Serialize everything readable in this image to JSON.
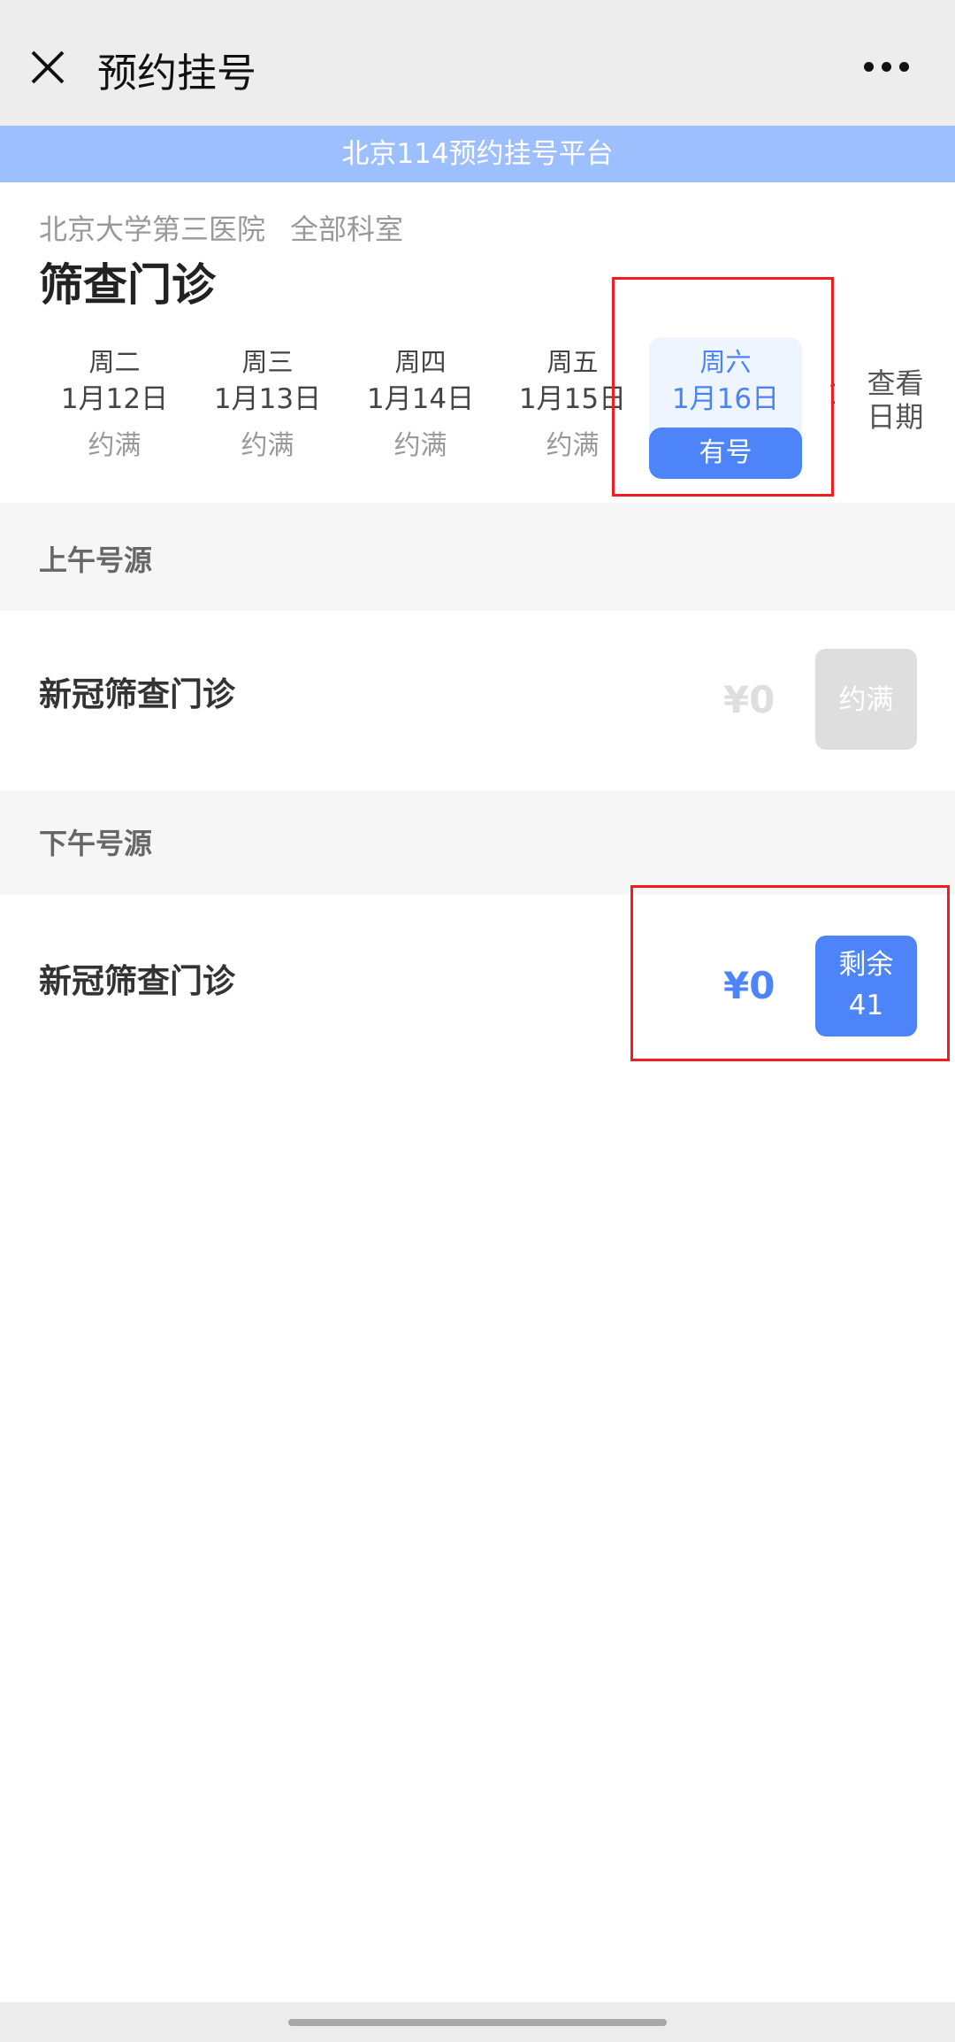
{
  "header": {
    "title": "预约挂号",
    "close_icon": "close-icon",
    "more_icon": "more-icon"
  },
  "banner": "北京114预约挂号平台",
  "hospital": {
    "name": "北京大学第三医院",
    "department_group": "全部科室",
    "department": "筛查门诊"
  },
  "dates": [
    {
      "weekday": "周二",
      "date": "1月12日",
      "status": "约满"
    },
    {
      "weekday": "周三",
      "date": "1月13日",
      "status": "约满"
    },
    {
      "weekday": "周四",
      "date": "1月14日",
      "status": "约满"
    },
    {
      "weekday": "周五",
      "date": "1月15日",
      "status": "约满"
    },
    {
      "weekday": "周六",
      "date": "1月16日",
      "status": "有号",
      "selected": true
    }
  ],
  "partial_next": "1",
  "view_dates": [
    "查看",
    "日期"
  ],
  "sections": [
    {
      "title": "上午号源",
      "item": {
        "name": "新冠筛查门诊",
        "price": "¥0",
        "button": "约满",
        "available": false
      }
    },
    {
      "title": "下午号源",
      "item": {
        "name": "新冠筛查门诊",
        "price": "¥0",
        "button_line1": "剩余",
        "button_line2": "41",
        "available": true
      }
    }
  ],
  "colors": {
    "accent": "#4d84fa",
    "banner": "#9dbffd",
    "disabled": "#dedede",
    "highlight_box": "#f41c1c"
  }
}
